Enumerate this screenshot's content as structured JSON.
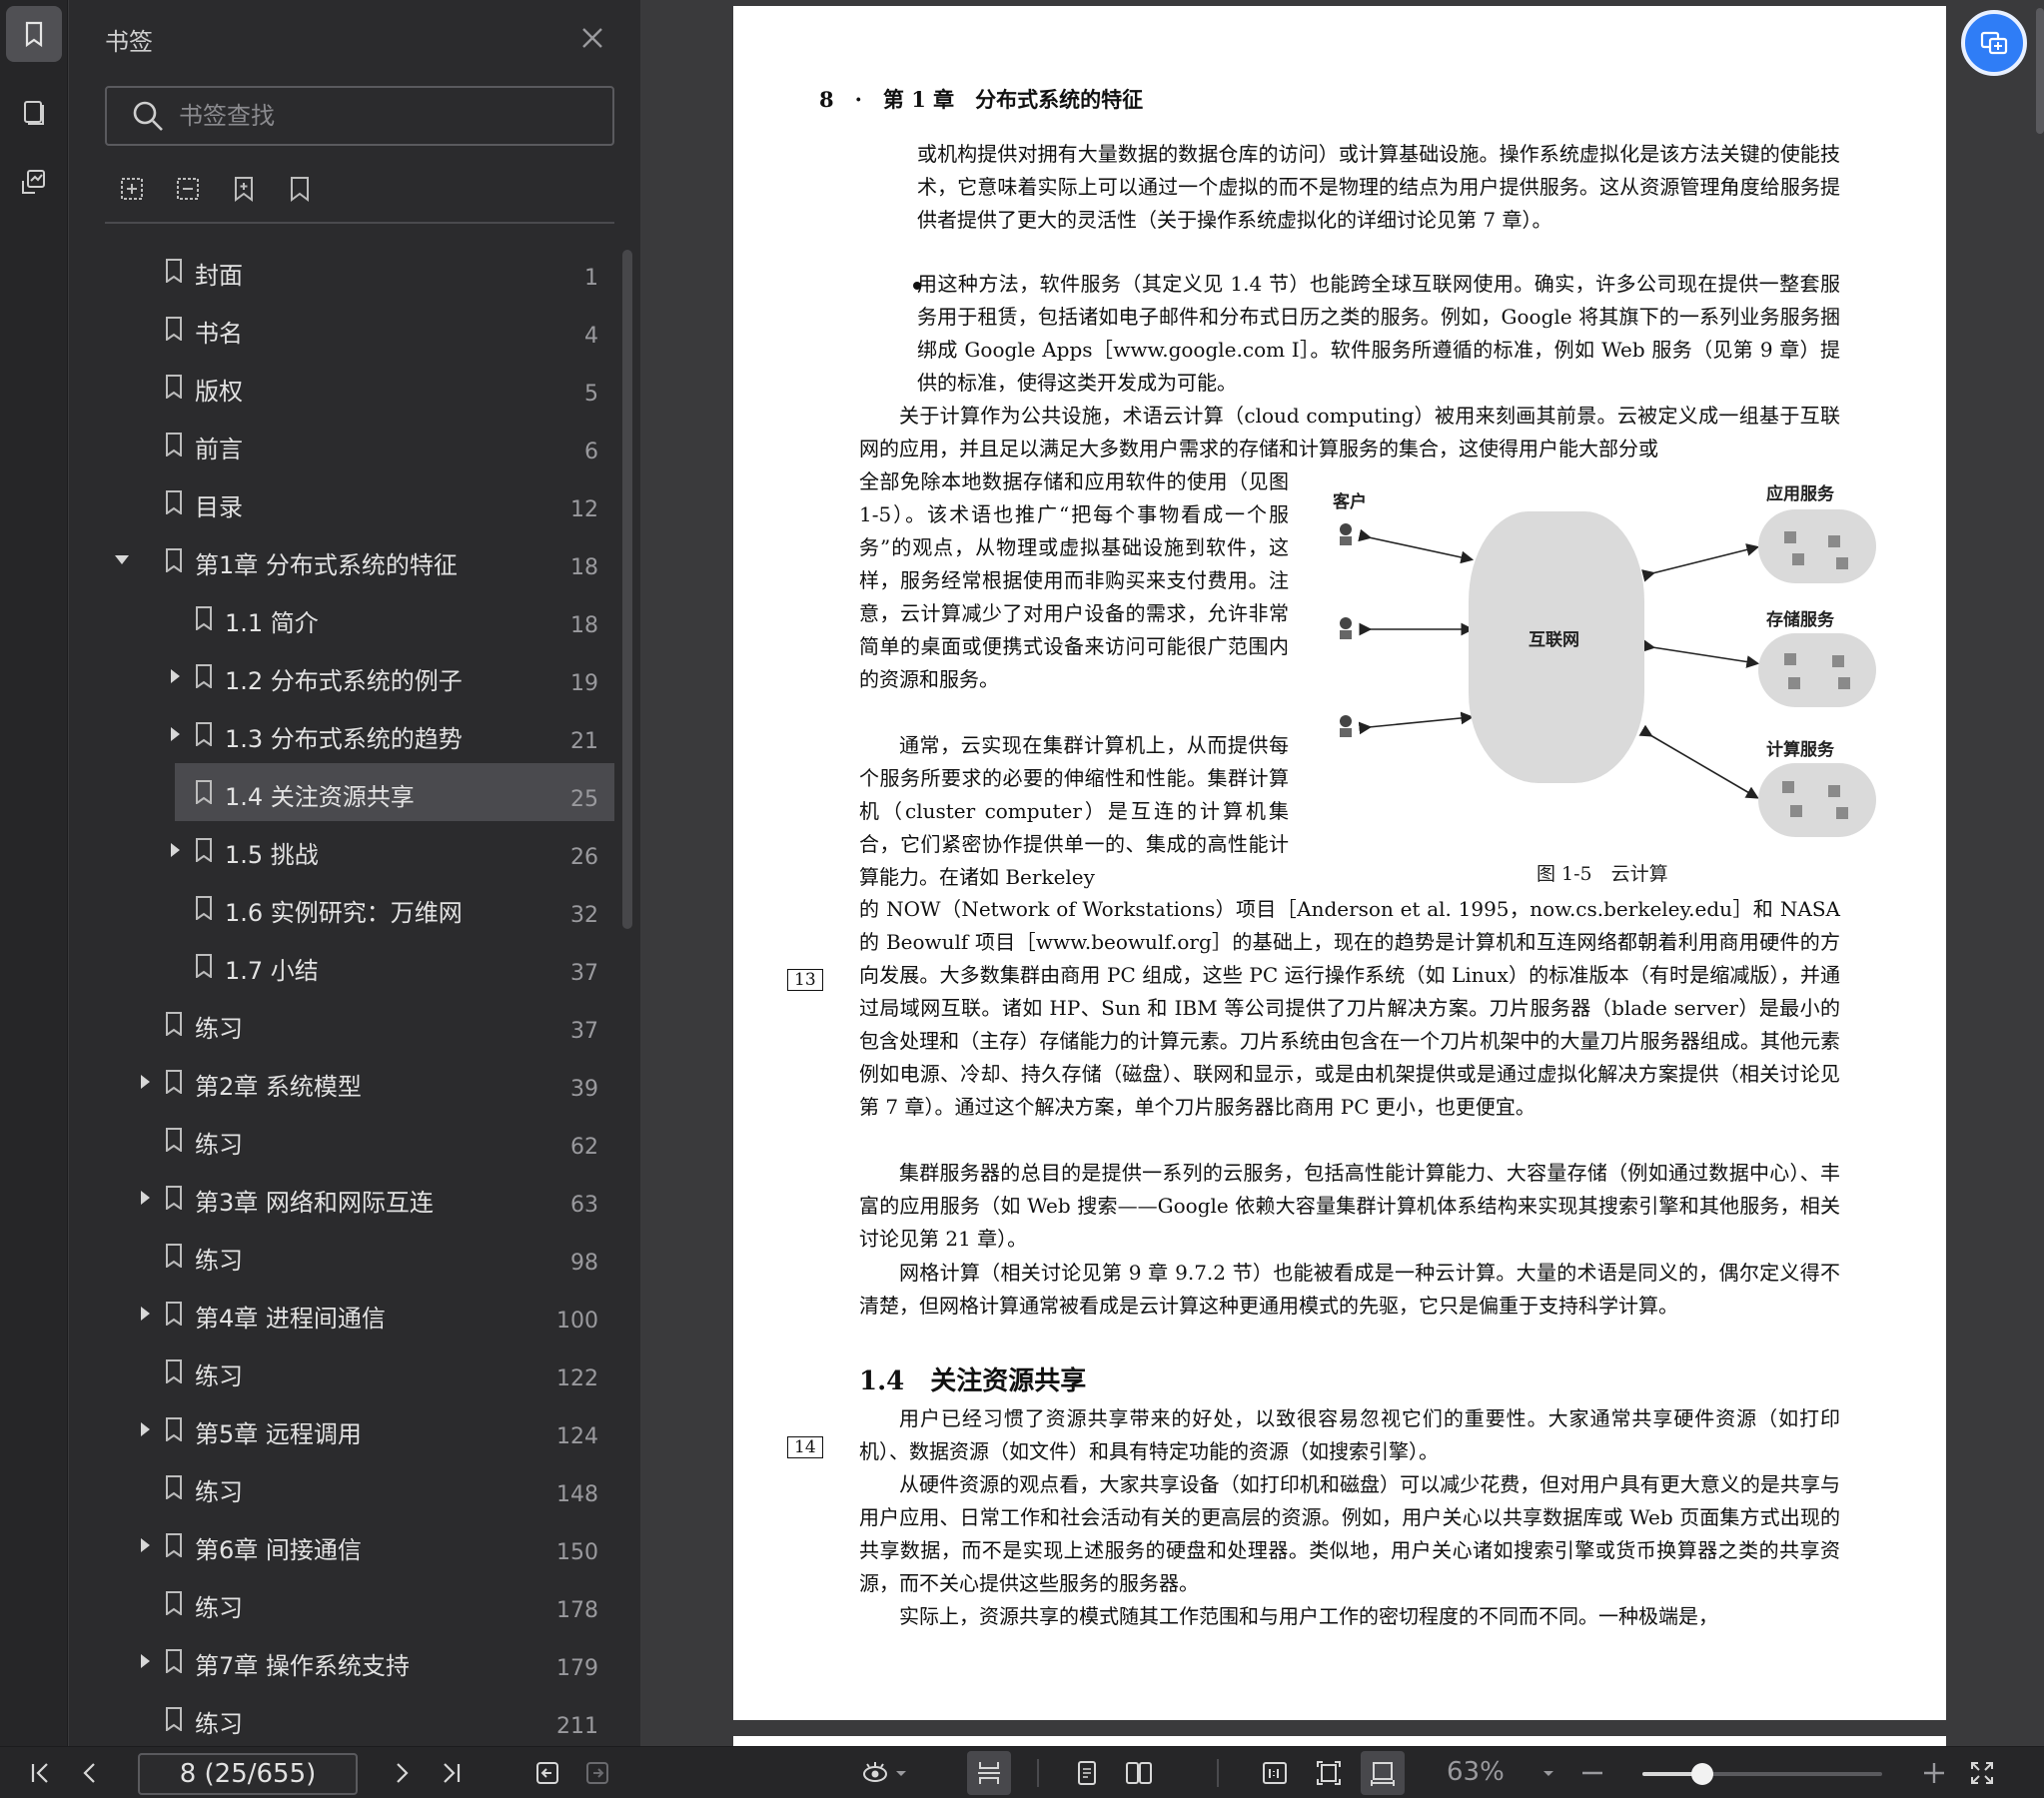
{
  "panel": {
    "title": "书签",
    "search_placeholder": "书签查找"
  },
  "toc": [
    {
      "label": "封面",
      "page": "1",
      "level": 0,
      "caret": "none"
    },
    {
      "label": "书名",
      "page": "4",
      "level": 0,
      "caret": "none"
    },
    {
      "label": "版权",
      "page": "5",
      "level": 0,
      "caret": "none"
    },
    {
      "label": "前言",
      "page": "6",
      "level": 0,
      "caret": "none"
    },
    {
      "label": "目录",
      "page": "12",
      "level": 0,
      "caret": "none"
    },
    {
      "label": "第1章 分布式系统的特征",
      "page": "18",
      "level": 0,
      "caret": "down"
    },
    {
      "label": "1.1 简介",
      "page": "18",
      "level": 1,
      "caret": "none"
    },
    {
      "label": "1.2 分布式系统的例子",
      "page": "19",
      "level": 1,
      "caret": "right"
    },
    {
      "label": "1.3 分布式系统的趋势",
      "page": "21",
      "level": 1,
      "caret": "right"
    },
    {
      "label": "1.4 关注资源共享",
      "page": "25",
      "level": 1,
      "caret": "none",
      "selected": true
    },
    {
      "label": "1.5 挑战",
      "page": "26",
      "level": 1,
      "caret": "right"
    },
    {
      "label": "1.6 实例研究：万维网",
      "page": "32",
      "level": 1,
      "caret": "none"
    },
    {
      "label": "1.7 小结",
      "page": "37",
      "level": 1,
      "caret": "none"
    },
    {
      "label": "练习",
      "page": "37",
      "level": 0,
      "caret": "none"
    },
    {
      "label": "第2章 系统模型",
      "page": "39",
      "level": 0,
      "caret": "right"
    },
    {
      "label": "练习",
      "page": "62",
      "level": 0,
      "caret": "none"
    },
    {
      "label": "第3章 网络和网际互连",
      "page": "63",
      "level": 0,
      "caret": "right"
    },
    {
      "label": "练习",
      "page": "98",
      "level": 0,
      "caret": "none"
    },
    {
      "label": "第4章 进程间通信",
      "page": "100",
      "level": 0,
      "caret": "right"
    },
    {
      "label": "练习",
      "page": "122",
      "level": 0,
      "caret": "none"
    },
    {
      "label": "第5章 远程调用",
      "page": "124",
      "level": 0,
      "caret": "right"
    },
    {
      "label": "练习",
      "page": "148",
      "level": 0,
      "caret": "none"
    },
    {
      "label": "第6章 间接通信",
      "page": "150",
      "level": 0,
      "caret": "right"
    },
    {
      "label": "练习",
      "page": "178",
      "level": 0,
      "caret": "none"
    },
    {
      "label": "第7章 操作系统支持",
      "page": "179",
      "level": 0,
      "caret": "right"
    },
    {
      "label": "练习",
      "page": "211",
      "level": 0,
      "caret": "none"
    }
  ],
  "document": {
    "running_head": "8　·　第 1 章　分布式系统的特征",
    "p1": "或机构提供对拥有大量数据的数据仓库的访问）或计算基础设施。操作系统虚拟化是该方法关键的使能技术，它意味着实际上可以通过一个虚拟的而不是物理的结点为用户提供服务。这从资源管理角度给服务提供者提供了更大的灵活性（关于操作系统虚拟化的详细讨论见第 7 章）。",
    "p2": "用这种方法，软件服务（其定义见 1.4 节）也能跨全球互联网使用。确实，许多公司现在提供一整套服务用于租赁，包括诸如电子邮件和分布式日历之类的服务。例如，Google 将其旗下的一系列业务服务捆绑成 Google Apps［www.google.com I］。软件服务所遵循的标准，例如 Web 服务（见第 9 章）提供的标准，使得这类开发成为可能。",
    "p3": "关于计算作为公共设施，术语云计算（cloud computing）被用来刻画其前景。云被定义成一组基于互联网的应用，并且足以满足大多数用户需求的存储和计算服务的集合，这使得用户能大部分或",
    "p4": "全部免除本地数据存储和应用软件的使用（见图 1-5）。该术语也推广“把每个事物看成一个服务”的观点，从物理或虚拟基础设施到软件，这样，服务经常根据使用而非购买来支付费用。注意，云计算减少了对用户设备的需求，允许非常简单的桌面或便携式设备来访问可能很广范围内的资源和服务。",
    "p5": "通常，云实现在集群计算机上，从而提供每个服务所要求的必要的伸缩性和性能。集群计算机（cluster computer）是互连的计算机集合，它们紧密协作提供单一的、集成的高性能计算能力。在诸如 Berkeley",
    "p6": "的 NOW（Network of Workstations）项目［Anderson et al. 1995，now.cs.berkeley.edu］和 NASA 的 Beowulf 项目［www.beowulf.org］的基础上，现在的趋势是计算机和互连网络都朝着利用商用硬件的方向发展。大多数集群由商用 PC 组成，这些 PC 运行操作系统（如 Linux）的标准版本（有时是缩减版），并通过局域网互联。诸如 HP、Sun 和 IBM 等公司提供了刀片解决方案。刀片服务器（blade server）是最小的包含处理和（主存）存储能力的计算元素。刀片系统由包含在一个刀片机架中的大量刀片服务器组成。其他元素例如电源、冷却、持久存储（磁盘）、联网和显示，或是由机架提供或是通过虚拟化解决方案提供（相关讨论见第 7 章）。通过这个解决方案，单个刀片服务器比商用 PC 更小，也更便宜。",
    "p7": "集群服务器的总目的是提供一系列的云服务，包括高性能计算能力、大容量存储（例如通过数据中心）、丰富的应用服务（如 Web 搜索——Google 依赖大容量集群计算机体系结构来实现其搜索引擎和其他服务，相关讨论见第 21 章）。",
    "p8": "网格计算（相关讨论见第 9 章 9.7.2 节）也能被看成是一种云计算。大量的术语是同义的，偶尔定义得不清楚，但网格计算通常被看成是云计算这种更通用模式的先驱，它只是偏重于支持科学计算。",
    "section": "1.4　关注资源共享",
    "p9": "用户已经习惯了资源共享带来的好处，以致很容易忽视它们的重要性。大家通常共享硬件资源（如打印机）、数据资源（如文件）和具有特定功能的资源（如搜索引擎）。",
    "p10": "从硬件资源的观点看，大家共享设备（如打印机和磁盘）可以减少花费，但对用户具有更大意义的是共享与用户应用、日常工作和社会活动有关的更高层的资源。例如，用户关心以共享数据库或 Web 页面集方式出现的共享数据，而不是实现上述服务的硬盘和处理器。类似地，用户关心诸如搜索引擎或货币换算器之类的共享资源，而不关心提供这些服务的服务器。",
    "p11": "实际上，资源共享的模式随其工作范围和与用户工作的密切程度的不同而不同。一种极端是，",
    "margin1": "13",
    "margin2": "14",
    "figure": {
      "client": "客户",
      "app": "应用服务",
      "storage": "存储服务",
      "compute": "计算服务",
      "internet": "互联网",
      "caption": "图 1-5　云计算"
    }
  },
  "toolbar": {
    "page_indicator": "8 (25/655)",
    "zoom": "63%",
    "zoom_fraction": 0.25
  },
  "colors": {
    "accent": "#2f7df6",
    "panel_bg": "#2b2b2d",
    "selected_row": "#4a4a4e"
  }
}
